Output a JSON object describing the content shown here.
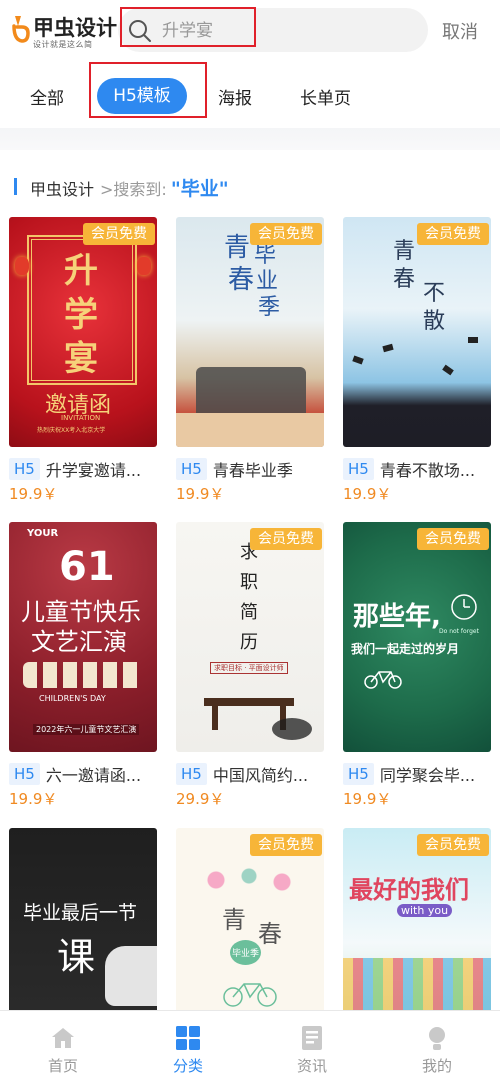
{
  "header": {
    "logo_name": "甲虫设计",
    "logo_slogan": "设计就是这么简",
    "search_placeholder": "升学宴",
    "cancel_label": "取消"
  },
  "tabs": {
    "all": "全部",
    "h5": "H5模板",
    "poster": "海报",
    "long_page": "长单页"
  },
  "breadcrumb": {
    "site": "甲虫设计",
    "arrow_label": ">搜索到:",
    "keyword": "\"毕业\""
  },
  "templates": [
    {
      "tag": "H5",
      "title": "升学宴邀请...",
      "price": "19.9￥",
      "badge": "会员免费",
      "poster": {
        "line1": "升",
        "line2": "学",
        "line3": "宴",
        "line4": "邀请函",
        "line5": "INVITATION",
        "line6": "热烈庆祝XX考入北京大学"
      }
    },
    {
      "tag": "H5",
      "title": "青春毕业季",
      "price": "19.9￥",
      "badge": "会员免费",
      "poster": {
        "line1": "青",
        "line2": "春",
        "line3": "毕",
        "line4": "业",
        "line5": "季"
      }
    },
    {
      "tag": "H5",
      "title": "青春不散场...",
      "price": "19.9￥",
      "badge": "会员免费",
      "poster": {
        "line1": "青",
        "line2": "春",
        "line3": "不",
        "line4": "散"
      }
    },
    {
      "tag": "H5",
      "title": "六一邀请函...",
      "price": "19.9￥",
      "badge": "会员免费",
      "poster": {
        "line1": "YOUR",
        "line2": "61",
        "line3": "儿童节快乐",
        "line4": "文艺汇演",
        "line5": "CHILDREN'S DAY",
        "line6": "2022年六一儿童节文艺汇演"
      }
    },
    {
      "tag": "H5",
      "title": "中国风简约...",
      "price": "29.9￥",
      "badge": "会员免费",
      "poster": {
        "line1": "求",
        "line2": "职",
        "line3": "简",
        "line4": "历",
        "line5": "求职目标 · 平面设计师"
      }
    },
    {
      "tag": "H5",
      "title": "同学聚会毕...",
      "price": "19.9￥",
      "badge": "会员免费",
      "poster": {
        "line1": "那些年,",
        "line2": "我们一起走过的岁月",
        "line3": "Do not forget"
      }
    },
    {
      "tag": "H5",
      "title": "",
      "price": "",
      "badge": "会员免费",
      "poster": {
        "line1": "毕业最后一节",
        "line2": "课"
      }
    },
    {
      "tag": "H5",
      "title": "",
      "price": "",
      "badge": "会员免费",
      "poster": {
        "line1": "青",
        "line2": "春",
        "line3": "毕业季"
      }
    },
    {
      "tag": "H5",
      "title": "",
      "price": "",
      "badge": "会员免费",
      "poster": {
        "line1": "最好的我们",
        "line2": "with you"
      }
    }
  ],
  "bottom_nav": [
    {
      "label": "首页",
      "icon": "home-icon"
    },
    {
      "label": "分类",
      "icon": "grid-icon"
    },
    {
      "label": "资讯",
      "icon": "news-icon"
    },
    {
      "label": "我的",
      "icon": "profile-icon"
    }
  ],
  "colors": {
    "accent": "#2e89f0",
    "badge": "#f7b538",
    "price": "#f08a22",
    "highlight_outline": "#e0202a"
  }
}
